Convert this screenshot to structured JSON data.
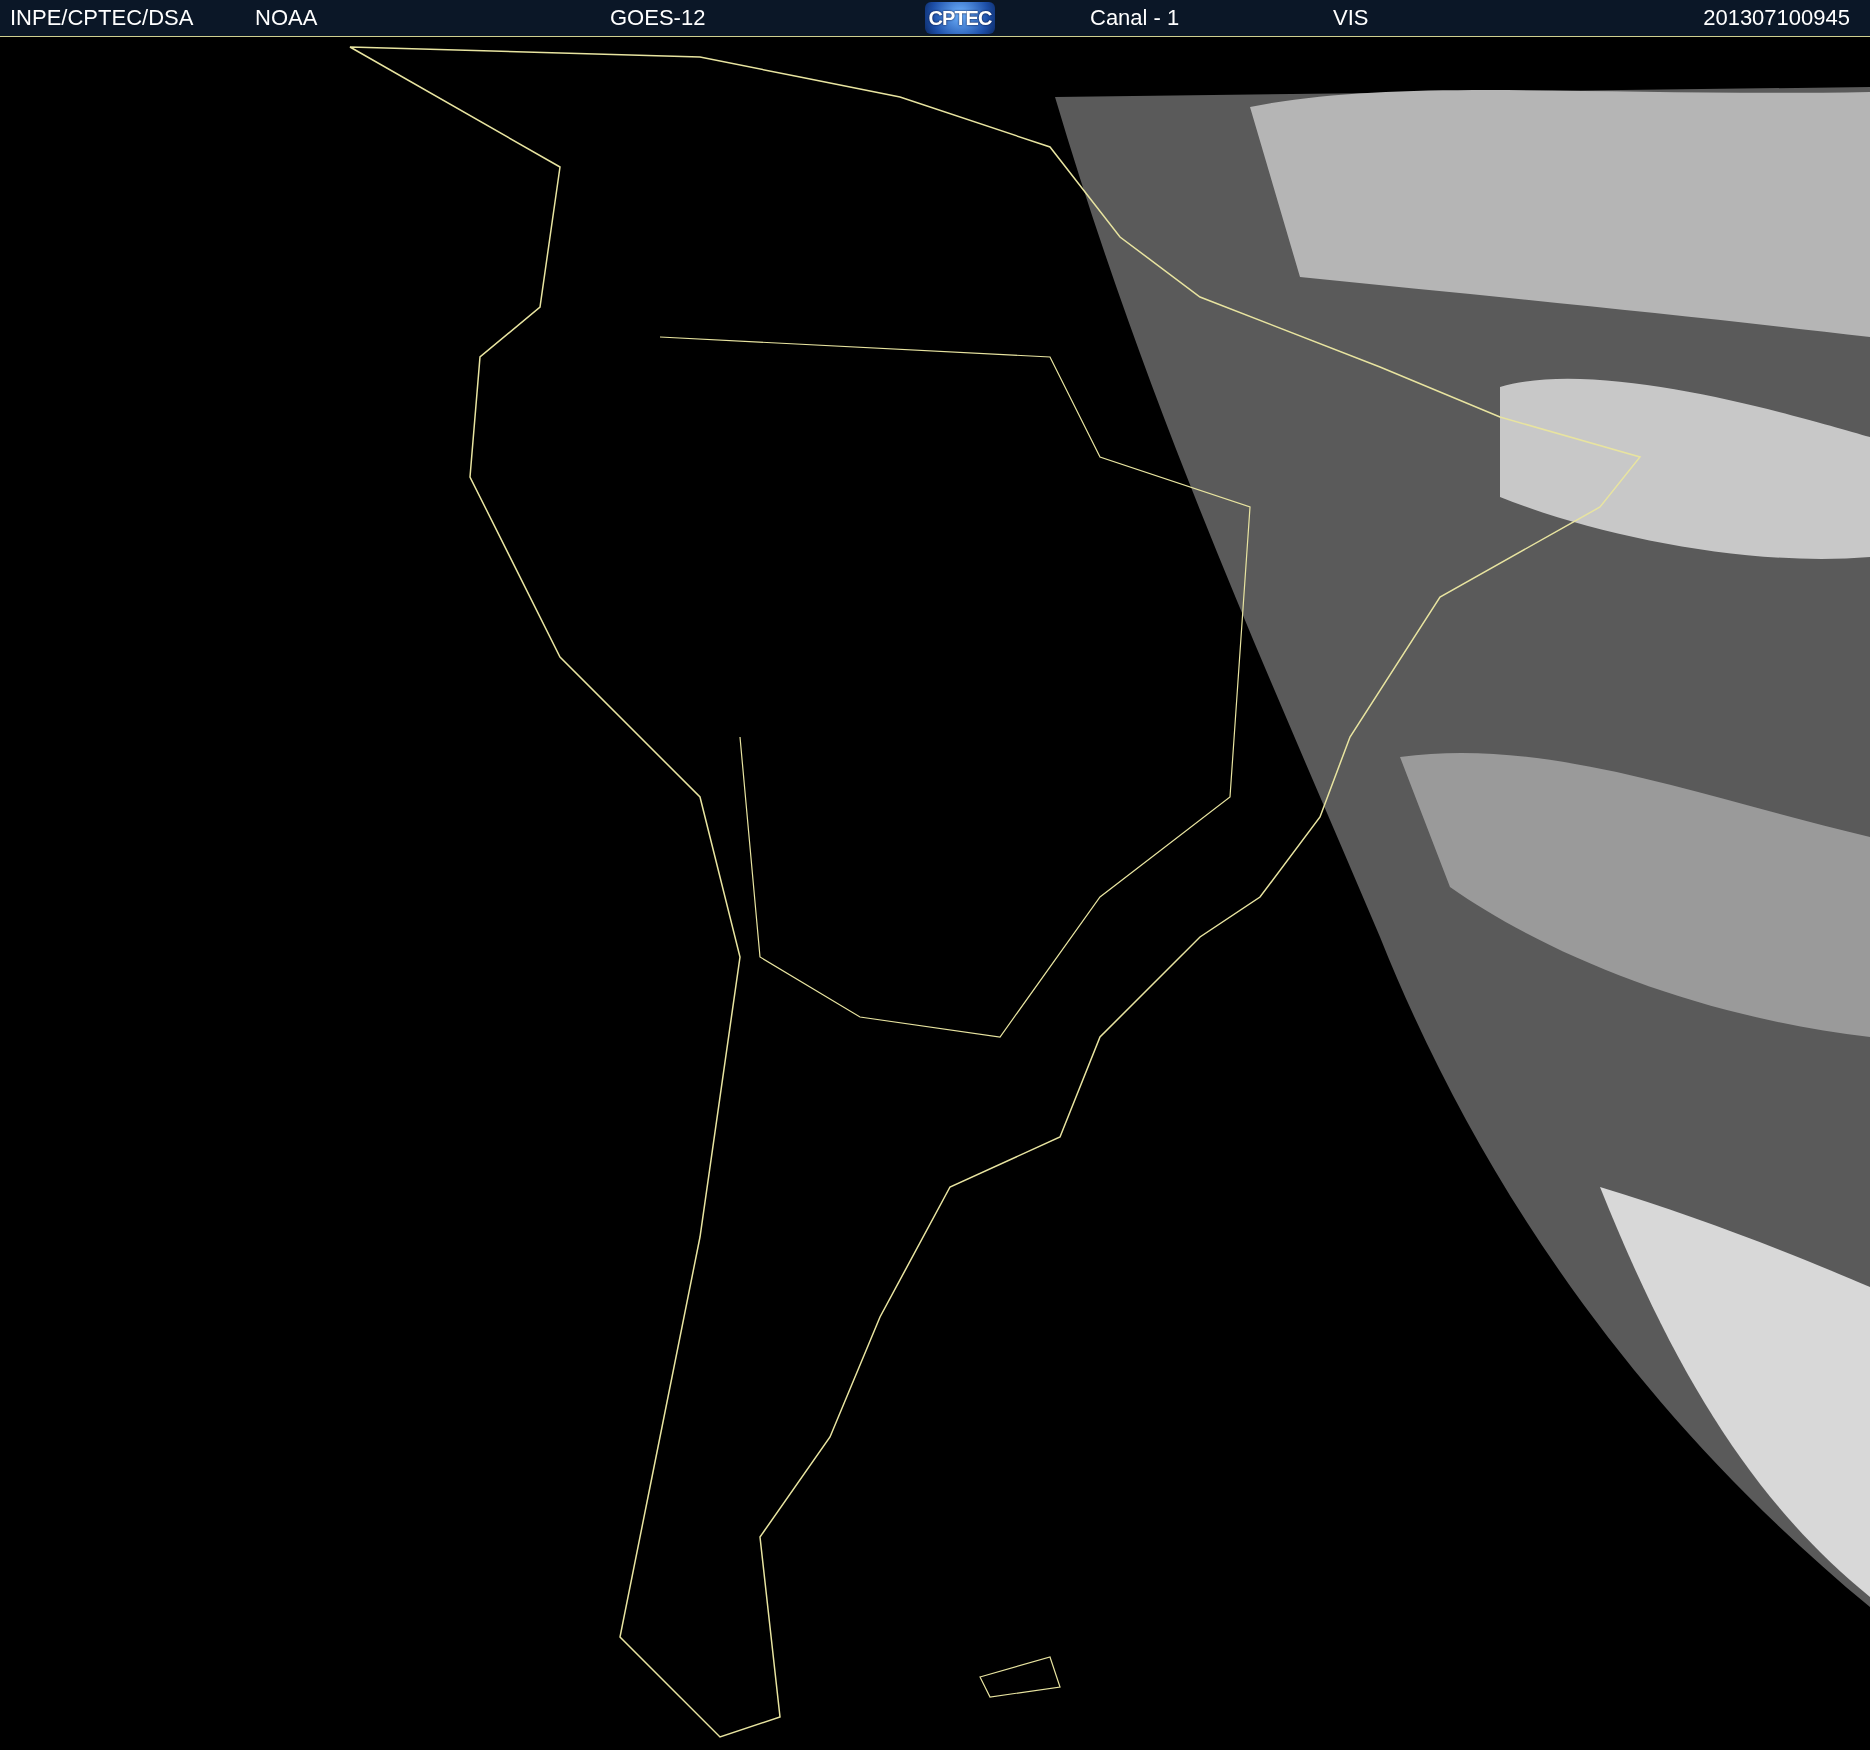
{
  "header": {
    "source": "INPE/CPTEC/DSA",
    "agency": "NOAA",
    "satellite": "GOES-12",
    "logo": "CPTEC",
    "channel": "Canal - 1",
    "band": "VIS",
    "timestamp": "201307100945"
  }
}
